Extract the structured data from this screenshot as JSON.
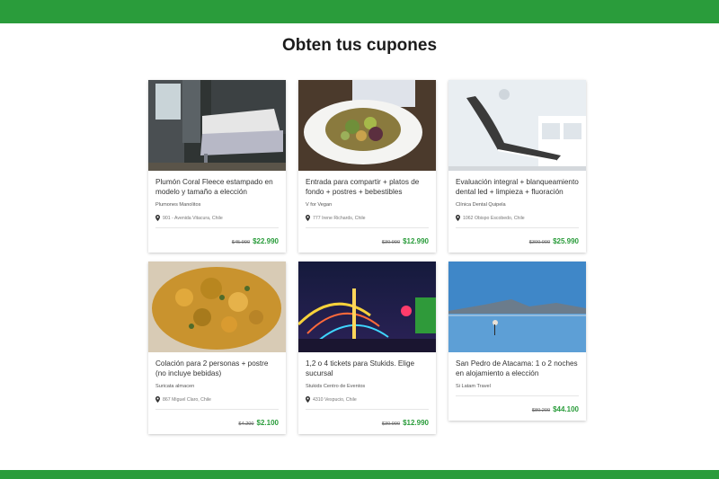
{
  "page": {
    "title": "Obten tus cupones"
  },
  "colors": {
    "brand": "#2a9c3b",
    "price": "#2a9c3b"
  },
  "cards": [
    {
      "image": "bedroom",
      "title": "Plumón Coral Fleece estampado en modelo y tamaño a elección",
      "vendor": "Plumones Manolitos",
      "location": "901 - Avenida Vitacura, Chile",
      "old_price": "$45.990",
      "price": "$22.990"
    },
    {
      "image": "salad-plate",
      "title": "Entrada para compartir + platos de fondo + postres + bebestibles",
      "vendor": "V for Vegan",
      "location": "777 Irene Richards, Chile",
      "old_price": "$30.990",
      "price": "$12.990"
    },
    {
      "image": "dental-chair",
      "title": "Evaluación integral + blanqueamiento dental led + limpieza + fluoración",
      "vendor": "Clínica Dental Quipela",
      "location": "1062 Obispo Escobedo, Chile",
      "old_price": "$300.000",
      "price": "$25.990"
    },
    {
      "image": "stew",
      "title": "Colación para 2 personas + postre (no incluye bebidas)",
      "vendor": "Suricata almacen",
      "location": "867 Miguel Claro, Chile",
      "old_price": "$4.200",
      "price": "$2.100"
    },
    {
      "image": "amusement-park",
      "title": "1,2 o 4 tickets para Stukids. Elige sucursal",
      "vendor": "Stukids Centro de Eventos",
      "location": "4310 Vespucio, Chile",
      "old_price": "$30.990",
      "price": "$12.990"
    },
    {
      "image": "atacama-lagoon",
      "title": "San Pedro de Atacama: 1 o 2 noches en alojamiento a elección",
      "vendor": "Si Latam Travel",
      "location": "",
      "old_price": "$80.200",
      "price": "$44.100"
    }
  ]
}
